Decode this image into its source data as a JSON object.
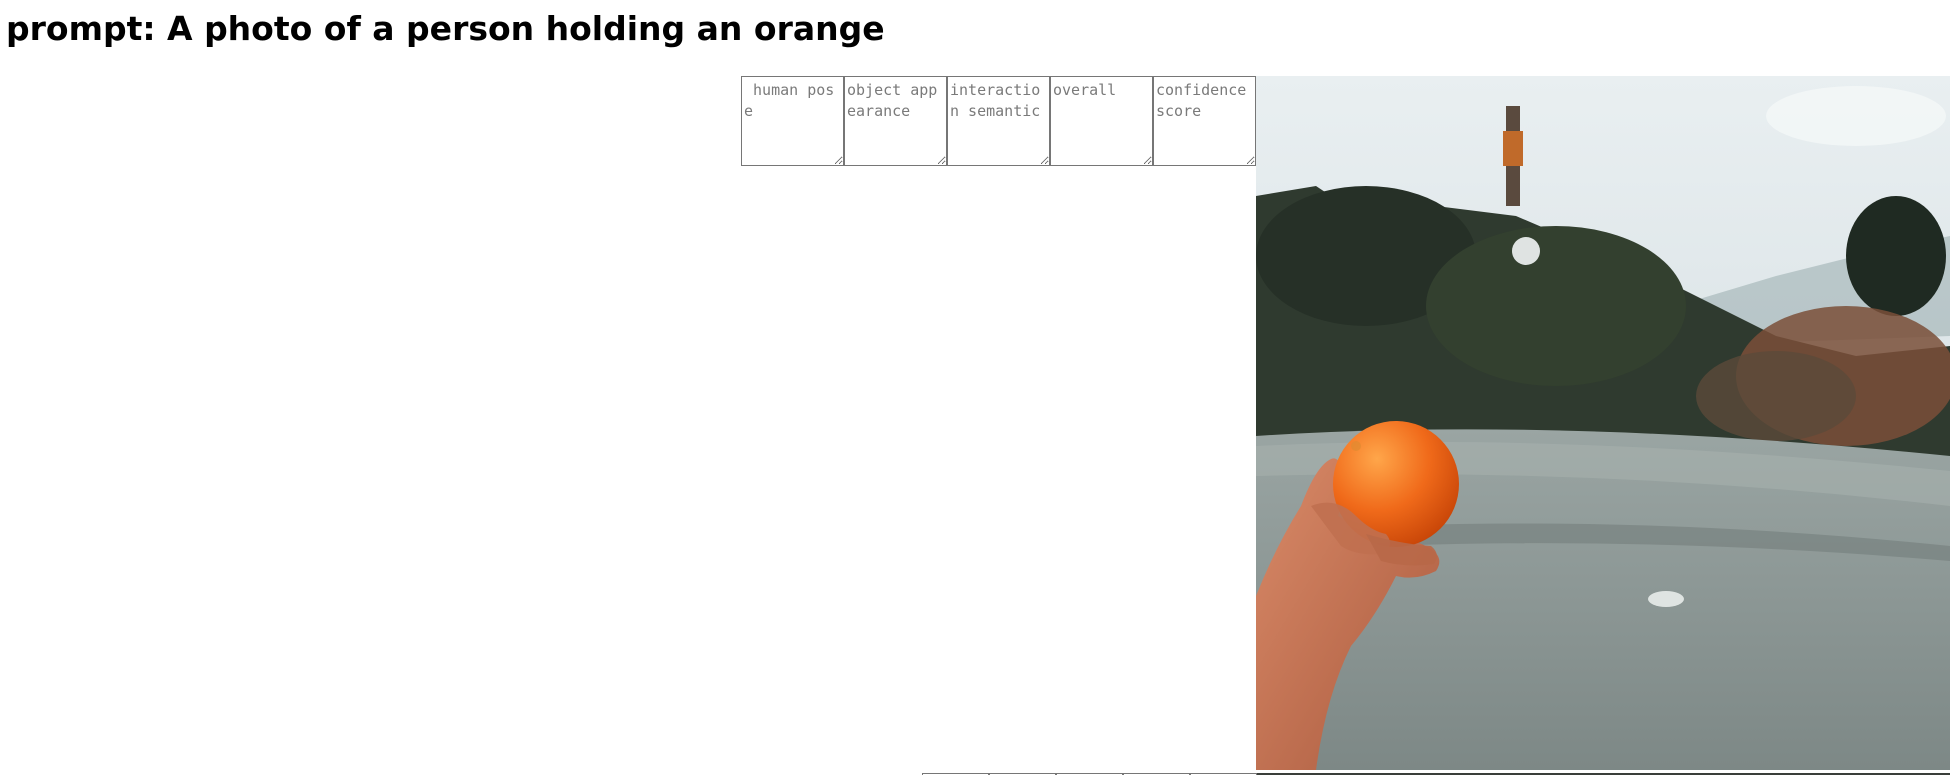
{
  "page": {
    "prompt_title": "prompt: A photo of a person holding an orange"
  },
  "score_fields": [
    {
      "placeholder": " human pose",
      "value": ""
    },
    {
      "placeholder": "object appearance",
      "value": ""
    },
    {
      "placeholder": "interaction semantic",
      "value": ""
    },
    {
      "placeholder": "overall",
      "value": ""
    },
    {
      "placeholder": "confidence score",
      "value": ""
    }
  ],
  "colors": {
    "orange": "#f06a1a",
    "sky": "#dfe7ea",
    "trees": "#2f3a2f",
    "road": "#8a9593"
  }
}
